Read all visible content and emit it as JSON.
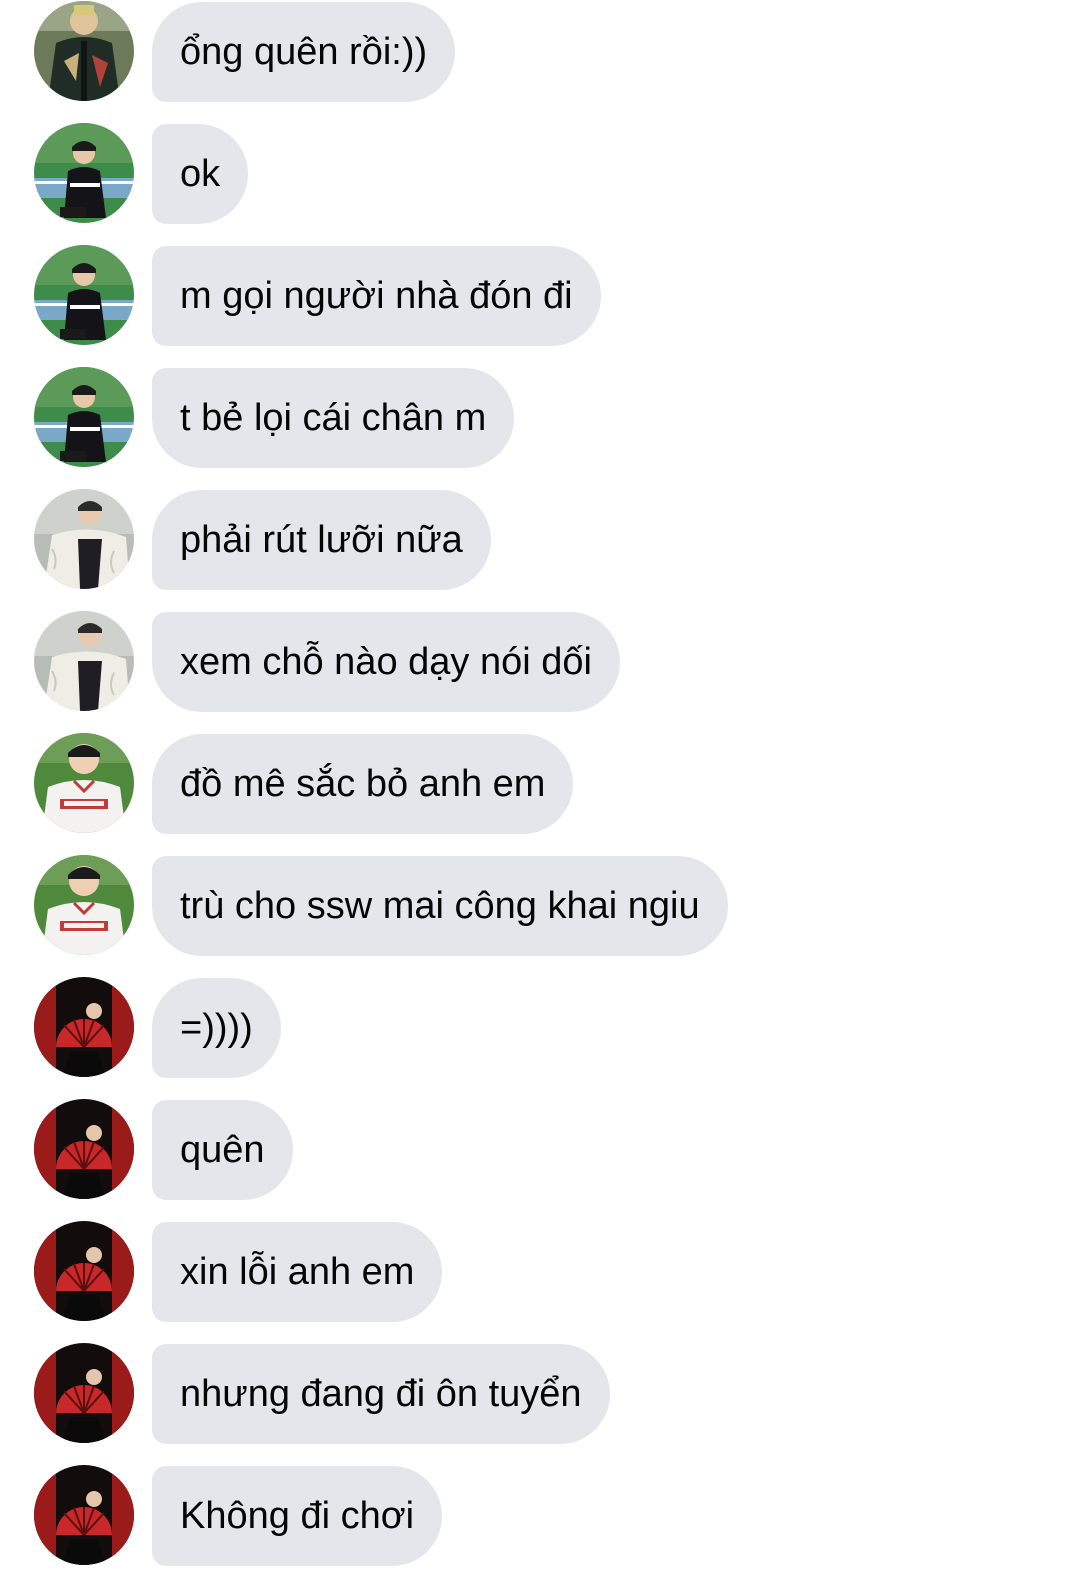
{
  "messages": [
    {
      "text": "ổng quên rồi:))",
      "avatar": "avatar-varsity-jacket"
    },
    {
      "text": "ok",
      "avatar": "avatar-court-squat"
    },
    {
      "text": "m gọi người nhà đón đi",
      "avatar": "avatar-court-squat"
    },
    {
      "text": "t bẻ lọi cái chân m",
      "avatar": "avatar-court-squat"
    },
    {
      "text": "phải rút lưỡi nữa",
      "avatar": "avatar-fleece-jacket"
    },
    {
      "text": "xem chỗ nào dạy nói dối",
      "avatar": "avatar-fleece-jacket"
    },
    {
      "text": "đồ mê sắc bỏ anh em",
      "avatar": "avatar-baseball-jersey"
    },
    {
      "text": "trù cho ssw mai công khai ngiu",
      "avatar": "avatar-baseball-jersey"
    },
    {
      "text": "=))))",
      "avatar": "avatar-red-fan"
    },
    {
      "text": "quên",
      "avatar": "avatar-red-fan"
    },
    {
      "text": "xin lỗi anh em",
      "avatar": "avatar-red-fan"
    },
    {
      "text": "nhưng đang đi ôn tuyển",
      "avatar": "avatar-red-fan"
    },
    {
      "text": "Không đi chơi",
      "avatar": "avatar-red-fan"
    }
  ],
  "colors": {
    "bubble_background": "#e4e6eb",
    "message_text": "#050505",
    "page_background": "#ffffff"
  }
}
